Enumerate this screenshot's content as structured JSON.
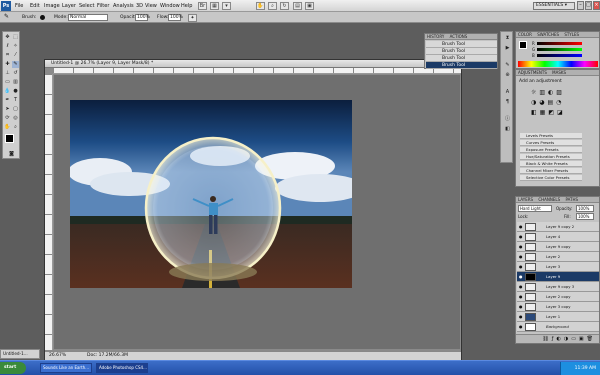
{
  "app": {
    "logo": "Ps",
    "essentials": "ESSENTIALS ▾"
  },
  "menu": [
    "File",
    "Edit",
    "Image",
    "Layer",
    "Select",
    "Filter",
    "Analysis",
    "3D",
    "View",
    "Window",
    "Help"
  ],
  "options": {
    "brush_label": "Brush:",
    "mode_label": "Mode:",
    "mode_value": "Normal",
    "opacity_label": "Opacity:",
    "opacity_value": "100%",
    "flow_label": "Flow:",
    "flow_value": "100%"
  },
  "document": {
    "title": "Untitled-1 @ 26.7% (Layer 9, Layer Mask/8) *",
    "zoom": "26.67%",
    "doc_info": "Doc: 17.2M/66.3M"
  },
  "history": {
    "tab_history": "HISTORY",
    "tab_actions": "ACTIONS",
    "items": [
      "Brush Tool",
      "Brush Tool",
      "Brush Tool",
      "Brush Tool"
    ]
  },
  "color_panel": {
    "tab_color": "COLOR",
    "tab_swatches": "SWATCHES",
    "tab_styles": "STYLES",
    "r": "R",
    "g": "G",
    "b": "B"
  },
  "adjustments": {
    "tab_adj": "ADJUSTMENTS",
    "tab_masks": "MASKS",
    "heading": "Add an adjustment",
    "presets": [
      "Levels Presets",
      "Curves Presets",
      "Exposure Presets",
      "Hue/Saturation Presets",
      "Black & White Presets",
      "Channel Mixer Presets",
      "Selective Color Presets"
    ]
  },
  "layers_panel": {
    "tab_layers": "LAYERS",
    "tab_channels": "CHANNELS",
    "tab_paths": "PATHS",
    "blend_mode": "Hard Light",
    "opacity_label": "Opacity:",
    "opacity_value": "100%",
    "lock_label": "Lock:",
    "fill_label": "Fill:",
    "fill_value": "100%",
    "layers": [
      "Layer 9 copy 2",
      "Layer 4",
      "Layer 9 copy",
      "Layer 2",
      "Layer 3",
      "Layer 9",
      "Layer 9 copy 3",
      "Layer 2 copy",
      "Layer 3 copy",
      "Layer 1",
      "Background"
    ]
  },
  "taskbar": {
    "start": "start",
    "tasks": [
      "Sounds Like an Earth...",
      "Adobe Photoshop CS4..."
    ],
    "clock": "11:39 AM"
  },
  "minimized_doc": "Untitled-1...",
  "colors": {
    "accent": "#1b3a66",
    "taskbar": "#2350a8"
  }
}
